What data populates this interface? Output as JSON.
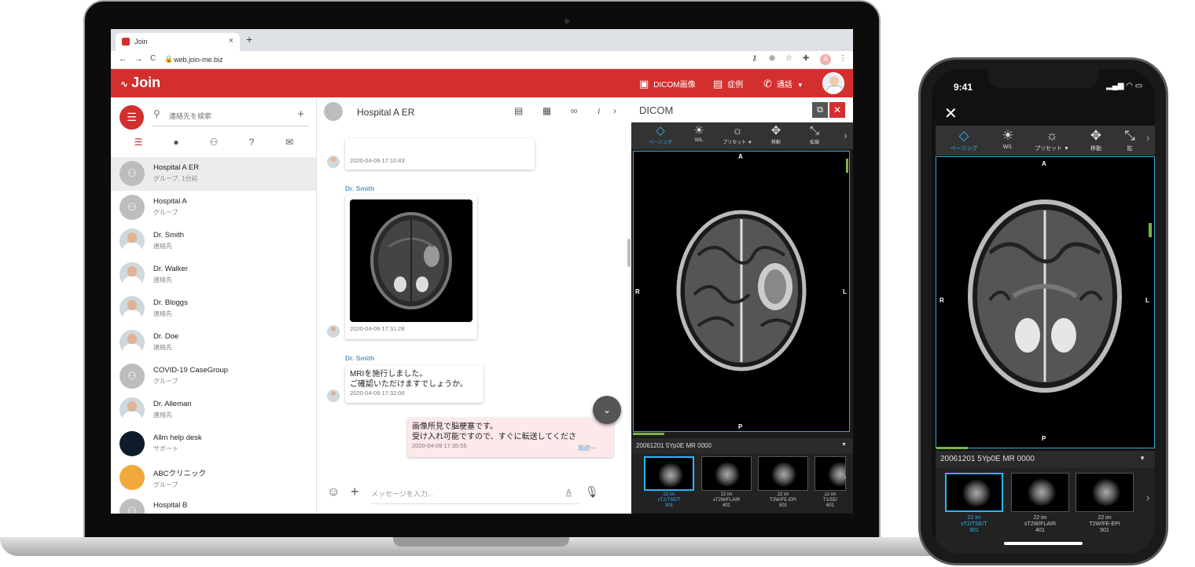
{
  "browser": {
    "tab_title": "Join",
    "tab_close": "×",
    "new_tab": "+",
    "back": "←",
    "forward": "→",
    "reload": "C",
    "url": "web.join-me.biz",
    "avatar_letter": "A"
  },
  "app": {
    "logo": "Join",
    "header_buttons": {
      "dicom": "DICOM画像",
      "cases": "症例",
      "call": "通話"
    },
    "brand_color": "#d32f2f"
  },
  "sidebar": {
    "search_placeholder": "連絡先を検索",
    "add": "+",
    "contacts": [
      {
        "name": "Hospital A ER",
        "sub": "グループ, 1分前",
        "selected": true,
        "type": "group"
      },
      {
        "name": "Hospital A",
        "sub": "グループ",
        "type": "group"
      },
      {
        "name": "Dr. Smith",
        "sub": "連絡先",
        "type": "person"
      },
      {
        "name": "Dr. Walker",
        "sub": "連絡先",
        "type": "person"
      },
      {
        "name": "Dr. Bloggs",
        "sub": "連絡先",
        "type": "person"
      },
      {
        "name": "Dr. Doe",
        "sub": "連絡先",
        "type": "person"
      },
      {
        "name": "COVID-19 CaseGroup",
        "sub": "グループ",
        "type": "group"
      },
      {
        "name": "Dr. Alleman",
        "sub": "連絡先",
        "type": "person"
      },
      {
        "name": "Allm help desk",
        "sub": "サポート",
        "type": "support"
      },
      {
        "name": "ABCクリニック",
        "sub": "グループ",
        "type": "clinic"
      },
      {
        "name": "Hospital B",
        "sub": "",
        "type": "group"
      }
    ]
  },
  "chat": {
    "title": "Hospital A ER",
    "messages": {
      "m1_time": "2020-04-09 17:10:43",
      "m2_sender": "Dr. Smith",
      "m2_time": "2020-04-09 17:31:28",
      "m3_sender": "Dr. Smith",
      "m3_line1": "MRIを施行しました。",
      "m3_line2": "ご確認いただけますでしょうか。",
      "m3_time": "2020-04-09 17:32:06",
      "m4_line1": "画像所見で脳梗塞です。",
      "m4_line2": "受け入れ可能ですので、すぐに転送してくださ",
      "m4_time": "2020-04-09 17:35:55",
      "m4_read": "既読一"
    },
    "composer_placeholder": "メッセージを入力...",
    "format_glyph": "A"
  },
  "dicom": {
    "title": "DICOM",
    "tools": [
      {
        "label": "ページング",
        "glyph": "◇",
        "active": true
      },
      {
        "label": "W/L",
        "glyph": "☀"
      },
      {
        "label": "プリセット ▼",
        "glyph": "☼"
      },
      {
        "label": "移動",
        "glyph": "✥"
      },
      {
        "label": "拡縮",
        "glyph": "⤡"
      }
    ],
    "orientation": {
      "top": "A",
      "bottom": "P",
      "left": "R",
      "right": "L"
    },
    "series_label": "20061201 5Yp0E MR 0000",
    "thumbnails": [
      {
        "line1": "22 im",
        "line2": "sT2/TSE/T",
        "line3": "301",
        "active": true
      },
      {
        "line1": "22 im",
        "line2": "sT2W/FLAIR",
        "line3": "401"
      },
      {
        "line1": "22 im",
        "line2": "T2W/FE-EPI",
        "line3": "501"
      },
      {
        "line1": "22 im",
        "line2": "T1/SE/",
        "line3": "601"
      }
    ]
  },
  "phone": {
    "time": "9:41",
    "close": "✕",
    "tools": [
      {
        "label": "ページング",
        "glyph": "◇",
        "active": true
      },
      {
        "label": "W/L",
        "glyph": "☀"
      },
      {
        "label": "プリセット ▼",
        "glyph": "☼"
      },
      {
        "label": "移動",
        "glyph": "✥"
      },
      {
        "label": "拡",
        "glyph": "⤡"
      }
    ],
    "orientation": {
      "top": "A",
      "bottom": "P",
      "left": "R",
      "right": "L"
    },
    "series_label": "20061201 5Yp0E MR 0000",
    "thumbnails": [
      {
        "line1": "22 im",
        "line2": "sT2/TSE/T",
        "line3": "301",
        "active": true
      },
      {
        "line1": "22 im",
        "line2": "sT2W/FLAIR",
        "line3": "401"
      },
      {
        "line1": "22 im",
        "line2": "T2W/FE-EPI",
        "line3": "501"
      }
    ]
  }
}
